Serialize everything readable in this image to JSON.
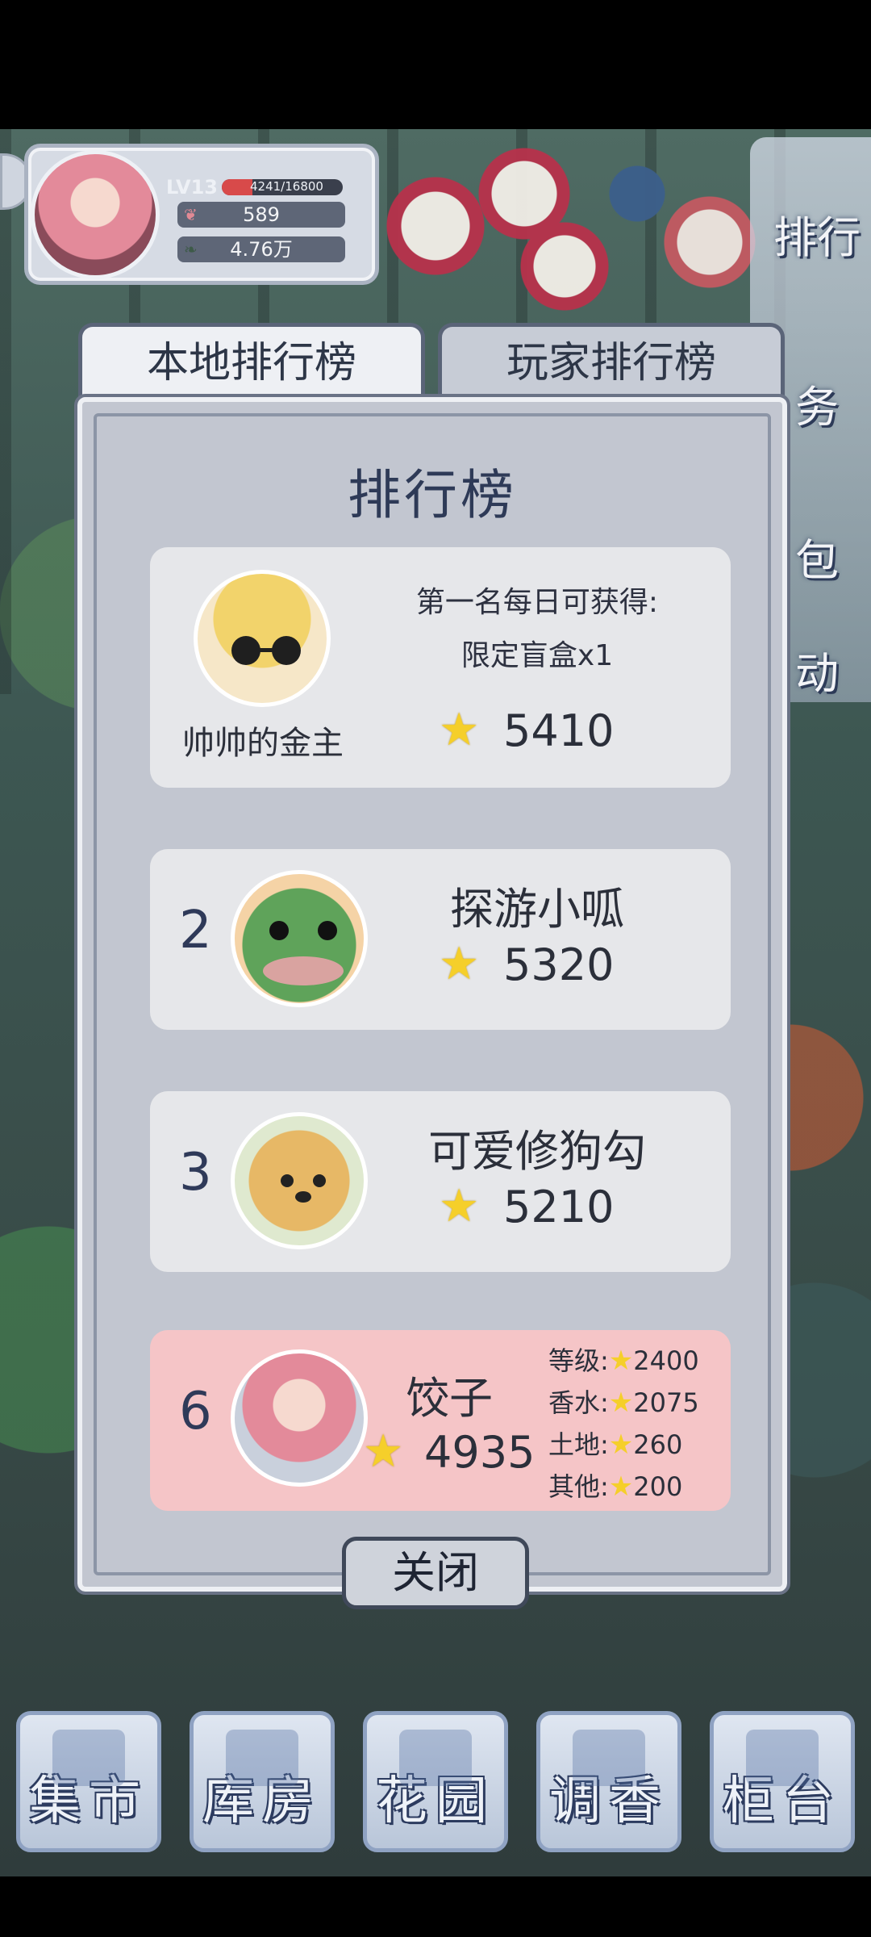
{
  "player": {
    "level": "LV13",
    "exp_text": "4241/16800",
    "exp_progress": 0.2524,
    "petals": "589",
    "money": "4.76万"
  },
  "side_menu": {
    "rank": "排行",
    "task": "务",
    "bag": "包",
    "activity": "动"
  },
  "tabs": {
    "local": "本地排行榜",
    "player": "玩家排行榜"
  },
  "panel": {
    "title": "排行榜",
    "first": {
      "name": "帅帅的金主",
      "reward_line1": "第一名每日可获得:",
      "reward_line2": "限定盲盒x1",
      "score": "5410"
    },
    "second": {
      "rank": "2",
      "name": "探游小呱",
      "score": "5320"
    },
    "third": {
      "rank": "3",
      "name": "可爱修狗勾",
      "score": "5210"
    },
    "me": {
      "rank": "6",
      "name": "饺子",
      "score": "4935",
      "level_label": "等级:",
      "level_value": "2400",
      "perfume_label": "香水:",
      "perfume_value": "2075",
      "land_label": "土地:",
      "land_value": "260",
      "other_label": "其他:",
      "other_value": "200"
    },
    "close": "关闭"
  },
  "bottom_nav": {
    "market": "集市",
    "warehouse": "库房",
    "garden": "花园",
    "blend": "调香",
    "counter": "柜台"
  },
  "colors": {
    "accent": "#2e3a57",
    "highlight_card": "#f5c5c7",
    "star": "#f5cf2a"
  },
  "icons": {
    "star": "star-icon",
    "petal": "petal-icon",
    "leaf": "leaf-icon"
  }
}
